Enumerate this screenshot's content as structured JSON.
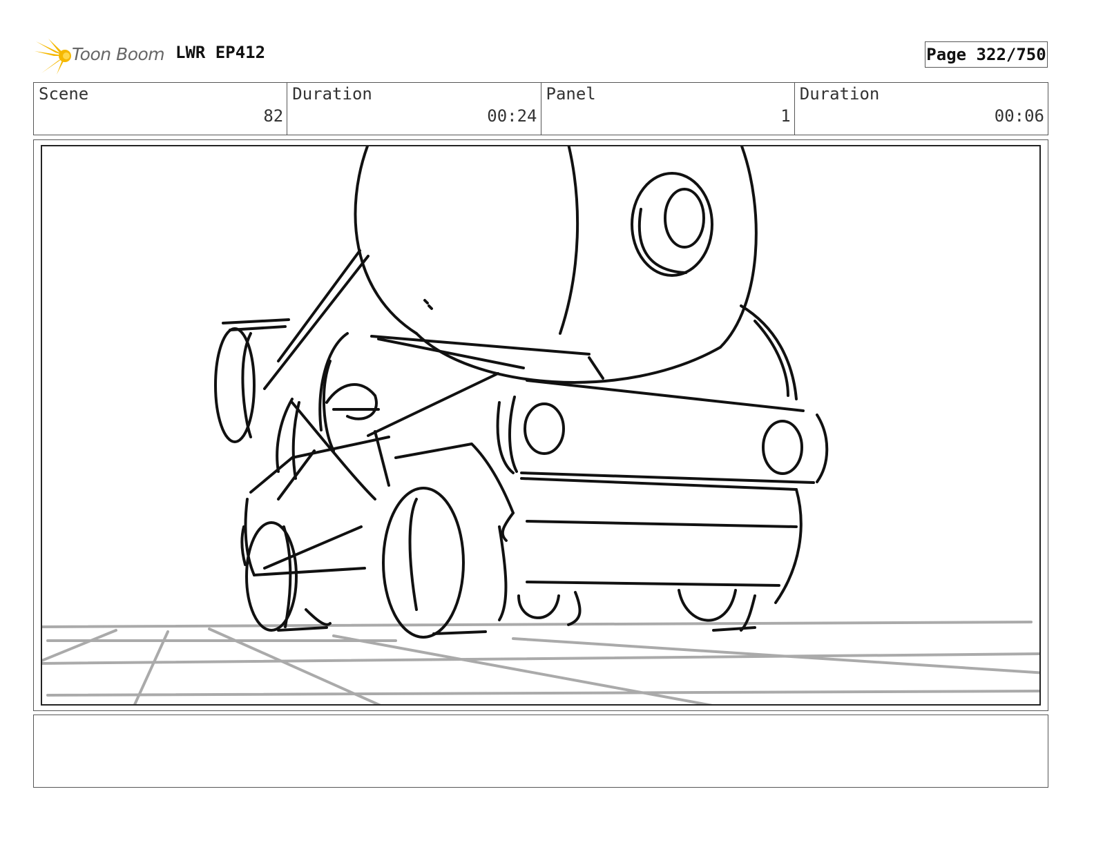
{
  "header": {
    "logo_text": "Toon Boom",
    "project_title": "LWR EP412",
    "page_indicator": "Page 322/750"
  },
  "info": {
    "scene_label": "Scene",
    "scene_value": "82",
    "scene_duration_label": "Duration",
    "scene_duration_value": "00:24",
    "panel_label": "Panel",
    "panel_value": "1",
    "panel_duration_label": "Duration",
    "panel_duration_value": "00:06"
  },
  "panel": {
    "sketch_icon": "storyboard-sketch-truck",
    "ink_color": "#111111",
    "floor_color": "#aaaaaa"
  },
  "notes": {
    "text": ""
  },
  "colors": {
    "logo_accent": "#f5b800",
    "border": "#555555"
  }
}
